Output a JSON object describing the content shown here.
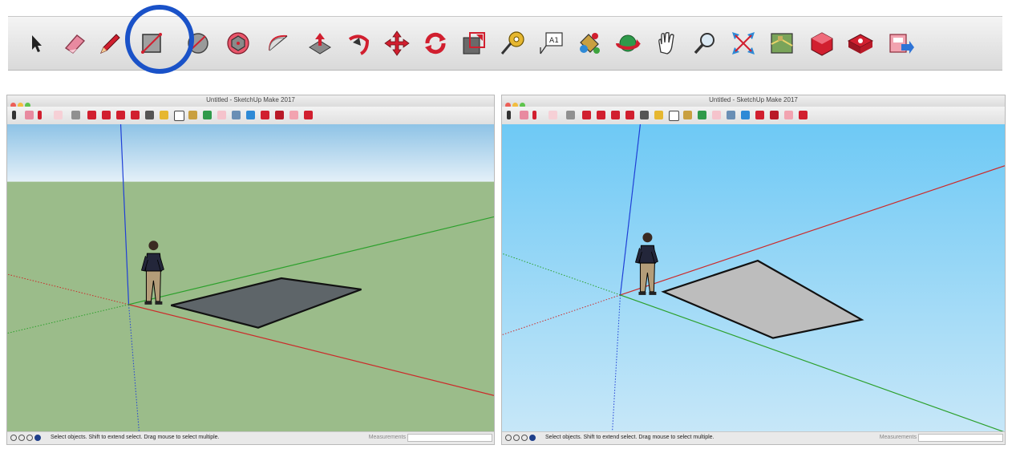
{
  "app": {
    "title": "Untitled - SketchUp Make 2017"
  },
  "big_toolbar": {
    "tools": [
      {
        "name": "select-tool-icon"
      },
      {
        "name": "eraser-tool-icon"
      },
      {
        "name": "line-tool-icon"
      },
      {
        "name": "rectangle-tool-icon"
      },
      {
        "name": "rotated-rectangle-tool-icon"
      },
      {
        "name": "polygon-tool-icon"
      },
      {
        "name": "arc-tool-icon"
      },
      {
        "name": "push-pull-tool-icon"
      },
      {
        "name": "follow-me-tool-icon"
      },
      {
        "name": "move-tool-icon"
      },
      {
        "name": "rotate-tool-icon"
      },
      {
        "name": "scale-tool-icon"
      },
      {
        "name": "tape-measure-tool-icon"
      },
      {
        "name": "text-tool-icon"
      },
      {
        "name": "paint-bucket-tool-icon"
      },
      {
        "name": "orbit-tool-icon"
      },
      {
        "name": "pan-tool-icon"
      },
      {
        "name": "zoom-tool-icon"
      },
      {
        "name": "zoom-extents-tool-icon"
      },
      {
        "name": "map-location-tool-icon"
      },
      {
        "name": "warehouse-tool-icon"
      },
      {
        "name": "extension-warehouse-tool-icon"
      },
      {
        "name": "send-to-layout-tool-icon"
      }
    ],
    "highlighted_tool": "rectangle-tool-icon",
    "text_tool_label": "A1"
  },
  "status": {
    "hint": "Select objects. Shift to extend select. Drag mouse to select multiple.",
    "measurements_label": "Measurements",
    "measurements_value": ""
  },
  "colors": {
    "highlight_ring": "#1a52c8",
    "ground_left": "#9bbc8a",
    "sky_left_top": "#9ecbe8",
    "sky_right": "#7ecdf5",
    "face_left": "#5e6569",
    "face_right": "#bdbdbd",
    "axis_red": "#cc2a2a",
    "axis_green": "#2ca02c",
    "axis_blue": "#1f3fd6"
  }
}
